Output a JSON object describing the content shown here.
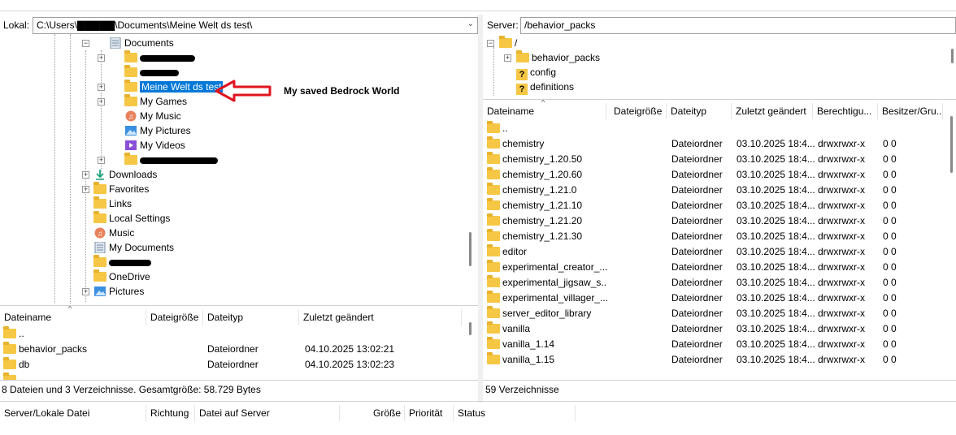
{
  "local": {
    "label": "Lokal:",
    "path": "C:\\Users\\▇▇▇▇▇\\Documents\\Meine Welt ds test\\",
    "tree": [
      {
        "label": "Documents",
        "icon": "documents-icon"
      },
      {
        "label": "",
        "icon": "folder-icon"
      },
      {
        "label": "",
        "icon": "folder-icon"
      },
      {
        "label": "Meine Welt ds test",
        "icon": "folder-icon",
        "selected": true
      },
      {
        "label": "My Games",
        "icon": "folder-icon"
      },
      {
        "label": "My Music",
        "icon": "music-icon"
      },
      {
        "label": "My Pictures",
        "icon": "pictures-icon"
      },
      {
        "label": "My Videos",
        "icon": "videos-icon"
      },
      {
        "label": "",
        "icon": "folder-icon"
      },
      {
        "label": "Downloads",
        "icon": "download-icon"
      },
      {
        "label": "Favorites",
        "icon": "folder-icon"
      },
      {
        "label": "Links",
        "icon": "folder-icon"
      },
      {
        "label": "Local Settings",
        "icon": "folder-icon"
      },
      {
        "label": "Music",
        "icon": "music-icon"
      },
      {
        "label": "My Documents",
        "icon": "documents-icon"
      },
      {
        "label": "",
        "icon": "folder-icon"
      },
      {
        "label": "OneDrive",
        "icon": "folder-icon"
      },
      {
        "label": "Pictures",
        "icon": "pictures-icon"
      }
    ],
    "annotation": "My saved Bedrock World",
    "columns": [
      "Dateiname",
      "Dateigröße",
      "Dateityp",
      "Zuletzt geändert"
    ],
    "files": [
      {
        "name": "..",
        "size": "",
        "type": "",
        "modified": ""
      },
      {
        "name": "behavior_packs",
        "size": "",
        "type": "Dateiordner",
        "modified": "04.10.2025 13:02:21"
      },
      {
        "name": "db",
        "size": "",
        "type": "Dateiordner",
        "modified": "04.10.2025 13:02:23"
      }
    ],
    "status": "8 Dateien und 3 Verzeichnisse. Gesamtgröße: 58.729 Bytes"
  },
  "remote": {
    "label": "Server:",
    "path": "/behavior_packs",
    "tree": [
      {
        "label": "/",
        "icon": "folder-icon"
      },
      {
        "label": "behavior_packs",
        "icon": "folder-icon"
      },
      {
        "label": "config",
        "icon": "unknown-folder-icon"
      },
      {
        "label": "definitions",
        "icon": "unknown-folder-icon"
      }
    ],
    "columns": [
      "Dateiname",
      "Dateigröße",
      "Dateityp",
      "Zuletzt geändert",
      "Berechtigu...",
      "Besitzer/Gru..."
    ],
    "files": [
      {
        "name": "..",
        "type": "",
        "modified": "",
        "perm": "",
        "owner": ""
      },
      {
        "name": "chemistry",
        "type": "Dateiordner",
        "modified": "03.10.2025 18:4...",
        "perm": "drwxrwxr-x",
        "owner": "0 0"
      },
      {
        "name": "chemistry_1.20.50",
        "type": "Dateiordner",
        "modified": "03.10.2025 18:4...",
        "perm": "drwxrwxr-x",
        "owner": "0 0"
      },
      {
        "name": "chemistry_1.20.60",
        "type": "Dateiordner",
        "modified": "03.10.2025 18:4...",
        "perm": "drwxrwxr-x",
        "owner": "0 0"
      },
      {
        "name": "chemistry_1.21.0",
        "type": "Dateiordner",
        "modified": "03.10.2025 18:4...",
        "perm": "drwxrwxr-x",
        "owner": "0 0"
      },
      {
        "name": "chemistry_1.21.10",
        "type": "Dateiordner",
        "modified": "03.10.2025 18:4...",
        "perm": "drwxrwxr-x",
        "owner": "0 0"
      },
      {
        "name": "chemistry_1.21.20",
        "type": "Dateiordner",
        "modified": "03.10.2025 18:4...",
        "perm": "drwxrwxr-x",
        "owner": "0 0"
      },
      {
        "name": "chemistry_1.21.30",
        "type": "Dateiordner",
        "modified": "03.10.2025 18:4...",
        "perm": "drwxrwxr-x",
        "owner": "0 0"
      },
      {
        "name": "editor",
        "type": "Dateiordner",
        "modified": "03.10.2025 18:4...",
        "perm": "drwxrwxr-x",
        "owner": "0 0"
      },
      {
        "name": "experimental_creator_...",
        "type": "Dateiordner",
        "modified": "03.10.2025 18:4...",
        "perm": "drwxrwxr-x",
        "owner": "0 0"
      },
      {
        "name": "experimental_jigsaw_s...",
        "type": "Dateiordner",
        "modified": "03.10.2025 18:4...",
        "perm": "drwxrwxr-x",
        "owner": "0 0"
      },
      {
        "name": "experimental_villager_...",
        "type": "Dateiordner",
        "modified": "03.10.2025 18:4...",
        "perm": "drwxrwxr-x",
        "owner": "0 0"
      },
      {
        "name": "server_editor_library",
        "type": "Dateiordner",
        "modified": "03.10.2025 18:4...",
        "perm": "drwxrwxr-x",
        "owner": "0 0"
      },
      {
        "name": "vanilla",
        "type": "Dateiordner",
        "modified": "03.10.2025 18:4...",
        "perm": "drwxrwxr-x",
        "owner": "0 0"
      },
      {
        "name": "vanilla_1.14",
        "type": "Dateiordner",
        "modified": "03.10.2025 18:4...",
        "perm": "drwxrwxr-x",
        "owner": "0 0"
      },
      {
        "name": "vanilla_1.15",
        "type": "Dateiordner",
        "modified": "03.10.2025 18:4...",
        "perm": "drwxrwxr-x",
        "owner": "0 0"
      }
    ],
    "status": "59 Verzeichnisse"
  },
  "queue": {
    "columns": [
      "Server/Lokale Datei",
      "Richtung",
      "Datei auf Server",
      "Größe",
      "Priorität",
      "Status"
    ]
  },
  "colors": {
    "selection": "#0078d7",
    "folder": "#f6c744",
    "annotation_arrow": "#e0141e"
  }
}
